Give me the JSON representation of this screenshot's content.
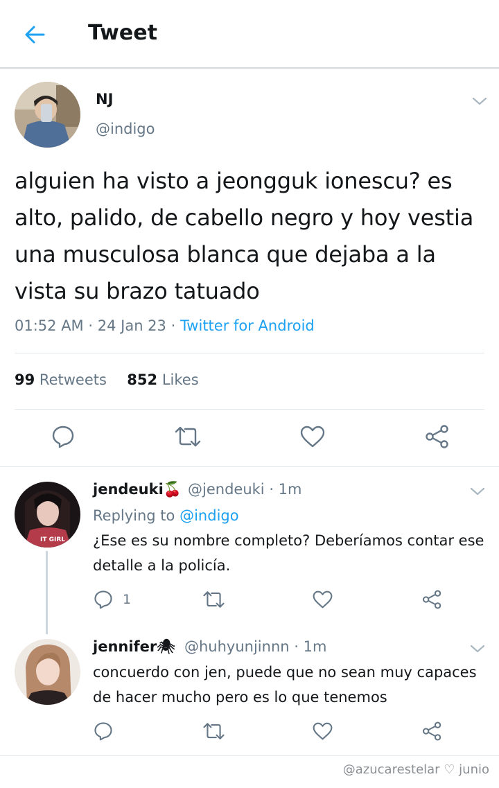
{
  "header": {
    "title": "Tweet"
  },
  "tweet": {
    "name": "NJ",
    "handle": "@indigo",
    "text": "alguien ha visto a jeongguk ionescu? es alto, palido, de cabello negro y hoy vestia una musculosa blanca que dejaba a la vista su brazo tatuado",
    "time": "01:52 AM",
    "date": "24 Jan 23",
    "source": "Twitter for Android",
    "retweets": "99",
    "retweets_label": "Retweets",
    "likes": "852",
    "likes_label": "Likes"
  },
  "replies": [
    {
      "name": "jendeuki🍒",
      "handle": "@jendeuki",
      "time": "1m",
      "replying_label": "Replying to",
      "replying_to": "@indigo",
      "text": "¿Ese es su nombre completo? Deberíamos contar ese detalle a la policía.",
      "reply_count": "1",
      "avatar_caption": "IT GIRL"
    },
    {
      "name": "jennifer🕷",
      "handle": "@huhyunjinnn",
      "time": "1m",
      "text": "concuerdo con jen, puede que no sean muy capaces de hacer mucho pero es lo que tenemos"
    }
  ],
  "watermark": "@azucarestelar ♡ junio",
  "colors": {
    "accent": "#1da1f2",
    "secondary_text": "#657786",
    "icon": "#657786",
    "divider": "#e1e8ed"
  },
  "icons": [
    "back-arrow-icon",
    "chevron-down-icon",
    "reply-icon",
    "retweet-icon",
    "like-icon",
    "share-icon"
  ]
}
